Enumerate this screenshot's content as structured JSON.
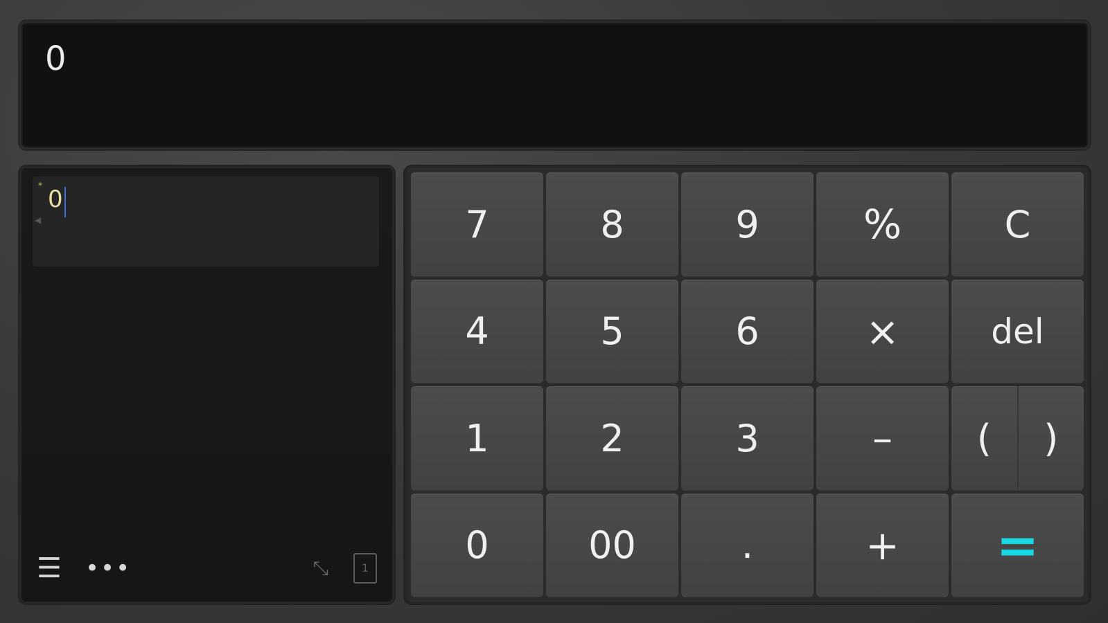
{
  "display": {
    "value": "0"
  },
  "history": {
    "expression": "0",
    "marker": "*",
    "toolbar": {
      "menu_icon": "☰",
      "more_icon": "•••",
      "expand_icon": "⤡",
      "panel_icon": "1"
    }
  },
  "keys": {
    "k7": "7",
    "k8": "8",
    "k9": "9",
    "percent": "%",
    "clear": "C",
    "k4": "4",
    "k5": "5",
    "k6": "6",
    "multiply": "×",
    "del": "del",
    "k1": "1",
    "k2": "2",
    "k3": "3",
    "minus": "–",
    "paren_open": "(",
    "paren_close": ")",
    "k0": "0",
    "k00": "00",
    "dot": ".",
    "plus": "+",
    "equals": "="
  },
  "colors": {
    "equals": "#19d6e3",
    "caret": "#3d6fd8",
    "history_text": "#e8e0a0"
  }
}
